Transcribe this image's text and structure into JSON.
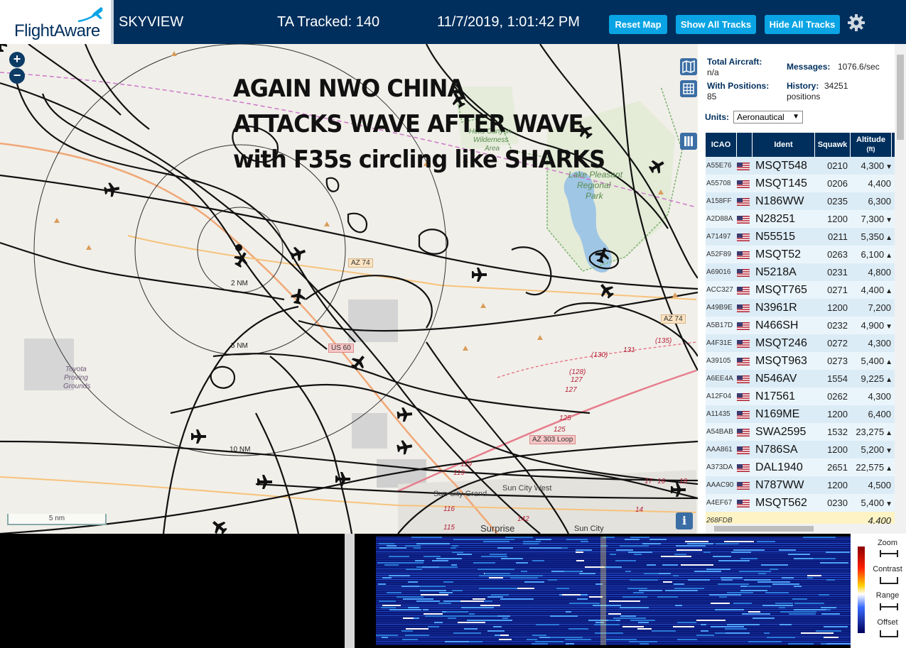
{
  "header": {
    "logo": "FlightAware",
    "app_name": "SKYVIEW",
    "tracked": "TA Tracked: 140",
    "datetime": "11/7/2019, 1:01:42 PM",
    "buttons": {
      "reset": "Reset Map",
      "show": "Show All Tracks",
      "hide": "Hide All Tracks"
    },
    "settings_icon": "gear-icon"
  },
  "map": {
    "zoom_in": "+",
    "zoom_out": "−",
    "scale": "5 nm",
    "info": "i",
    "overlay": [
      "AGAIN NWO CHINA",
      "ATTACKS WAVE AFTER WAVE",
      "with F35s circling like SHARKS"
    ],
    "labels": {
      "hells_canyon": "Hells Canyon",
      "wilderness": "Wilderness",
      "area": "Area",
      "lake": "Lake Pleasant",
      "regional": "Regional",
      "park": "Park",
      "toyota1": "Toyota",
      "toyota2": "Proving",
      "toyota3": "Grounds",
      "az74a": "AZ 74",
      "az74b": "AZ 74",
      "us60": "US 60",
      "az303": "AZ 303 Loop",
      "sun_city_grand": "Sun City Grand",
      "sun_city_west": "Sun City West",
      "surprise": "Surprise",
      "sun_city": "Sun City",
      "nm2": "2 NM",
      "nm5": "5 NM",
      "nm10": "10 NM",
      "r130": "(130)",
      "r131": "131",
      "r135": "(135)",
      "r128": "(128)",
      "r127a": "127",
      "r127b": "127",
      "r125a": "125",
      "r125b": "125",
      "r119a": "119",
      "r119b": "119",
      "r116": "116",
      "r115": "115",
      "r142": "142",
      "r14": "14",
      "r17": "17",
      "r16": "16",
      "r18": "18"
    }
  },
  "sidebar": {
    "total_aircraft_label": "Total Aircraft:",
    "total_aircraft": "n/a",
    "messages_label": "Messages:",
    "messages": "1076.6/sec",
    "with_positions_label": "With Positions:",
    "with_positions": "85",
    "history_label": "History:",
    "history": "34251",
    "history_unit": "positions",
    "units_label": "Units:",
    "units_value": "Aeronautical",
    "columns": {
      "icao": "ICAO",
      "ident": "Ident",
      "squawk": "Squawk",
      "alt1": "Altitude",
      "alt2": "(ft)"
    },
    "rows": [
      {
        "icao": "A55E76",
        "ident": "MSQT548",
        "squawk": "0210",
        "alt": "4,300",
        "trend": "▼"
      },
      {
        "icao": "A55708",
        "ident": "MSQT145",
        "squawk": "0206",
        "alt": "4,400",
        "trend": ""
      },
      {
        "icao": "A158FF",
        "ident": "N186WW",
        "squawk": "0235",
        "alt": "6,300",
        "trend": ""
      },
      {
        "icao": "A2D88A",
        "ident": "N28251",
        "squawk": "1200",
        "alt": "7,300",
        "trend": "▼"
      },
      {
        "icao": "A71497",
        "ident": "N55515",
        "squawk": "0211",
        "alt": "5,350",
        "trend": "▲"
      },
      {
        "icao": "A52F89",
        "ident": "MSQT52",
        "squawk": "0263",
        "alt": "6,100",
        "trend": "▲"
      },
      {
        "icao": "A69016",
        "ident": "N5218A",
        "squawk": "0231",
        "alt": "4,800",
        "trend": ""
      },
      {
        "icao": "ACC327",
        "ident": "MSQT765",
        "squawk": "0271",
        "alt": "4,400",
        "trend": "▲"
      },
      {
        "icao": "A49B9E",
        "ident": "N3961R",
        "squawk": "1200",
        "alt": "7,200",
        "trend": ""
      },
      {
        "icao": "A5B17D",
        "ident": "N466SH",
        "squawk": "0232",
        "alt": "4,900",
        "trend": "▼"
      },
      {
        "icao": "A4F31E",
        "ident": "MSQT246",
        "squawk": "0272",
        "alt": "4,300",
        "trend": ""
      },
      {
        "icao": "A39105",
        "ident": "MSQT963",
        "squawk": "0273",
        "alt": "5,400",
        "trend": "▲"
      },
      {
        "icao": "A6EE4A",
        "ident": "N546AV",
        "squawk": "1554",
        "alt": "9,225",
        "trend": "▲"
      },
      {
        "icao": "A12F04",
        "ident": "N17561",
        "squawk": "0262",
        "alt": "4,300",
        "trend": ""
      },
      {
        "icao": "A11435",
        "ident": "N169ME",
        "squawk": "1200",
        "alt": "6,400",
        "trend": ""
      },
      {
        "icao": "A54BAB",
        "ident": "SWA2595",
        "squawk": "1532",
        "alt": "23,275",
        "trend": "▲"
      },
      {
        "icao": "AAA861",
        "ident": "N786SA",
        "squawk": "1200",
        "alt": "5,200",
        "trend": "▼"
      },
      {
        "icao": "A373DA",
        "ident": "DAL1940",
        "squawk": "2651",
        "alt": "22,575",
        "trend": "▲"
      },
      {
        "icao": "AAAC90",
        "ident": "N787WW",
        "squawk": "1200",
        "alt": "4,500",
        "trend": ""
      },
      {
        "icao": "A4EF67",
        "ident": "MSQT562",
        "squawk": "0230",
        "alt": "5,400",
        "trend": "▼"
      },
      {
        "icao": "268FDB",
        "ident": "",
        "squawk": "",
        "alt": "4,400",
        "trend": ""
      }
    ]
  },
  "waterfall": {
    "zoom": "Zoom",
    "contrast": "Contrast",
    "range": "Range",
    "offset": "Offset"
  },
  "colors": {
    "header_bg": "#002f5d",
    "button": "#0aa4e4",
    "table_header": "#002f5d",
    "row_a": "#dcecf6",
    "row_b": "#eaf5fb"
  }
}
